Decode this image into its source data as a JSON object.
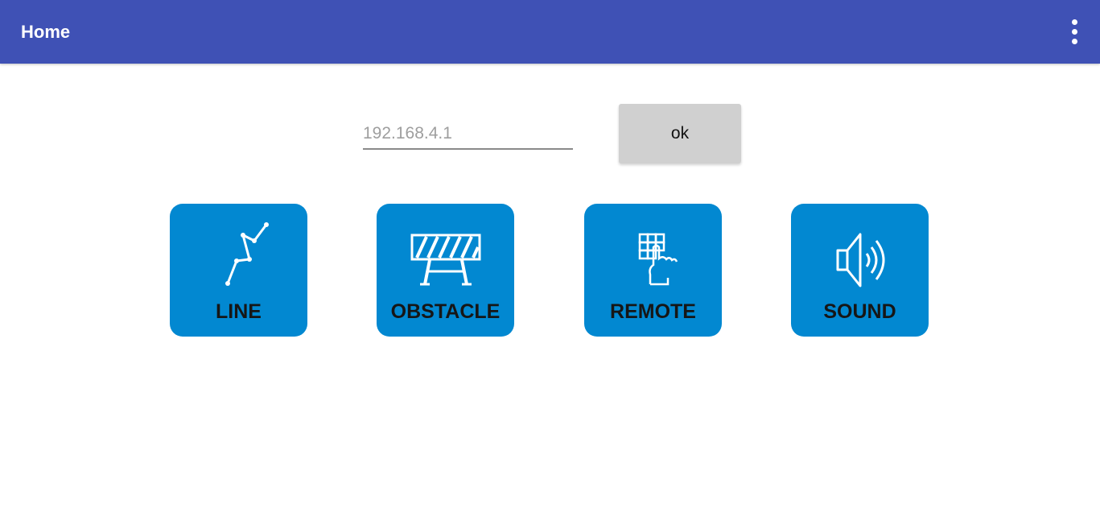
{
  "appbar": {
    "title": "Home",
    "menu_icon": "more-vert-icon"
  },
  "connection": {
    "ip_placeholder": "192.168.4.1",
    "ip_value": "",
    "ok_label": "ok"
  },
  "tiles": [
    {
      "label": "LINE",
      "icon": "line-path-icon"
    },
    {
      "label": "OBSTACLE",
      "icon": "barrier-icon"
    },
    {
      "label": "REMOTE",
      "icon": "keypad-hand-icon"
    },
    {
      "label": "SOUND",
      "icon": "speaker-icon"
    }
  ],
  "colors": {
    "appbar": "#3f51b5",
    "tile": "#0288d1",
    "button": "#d0d0d0"
  }
}
